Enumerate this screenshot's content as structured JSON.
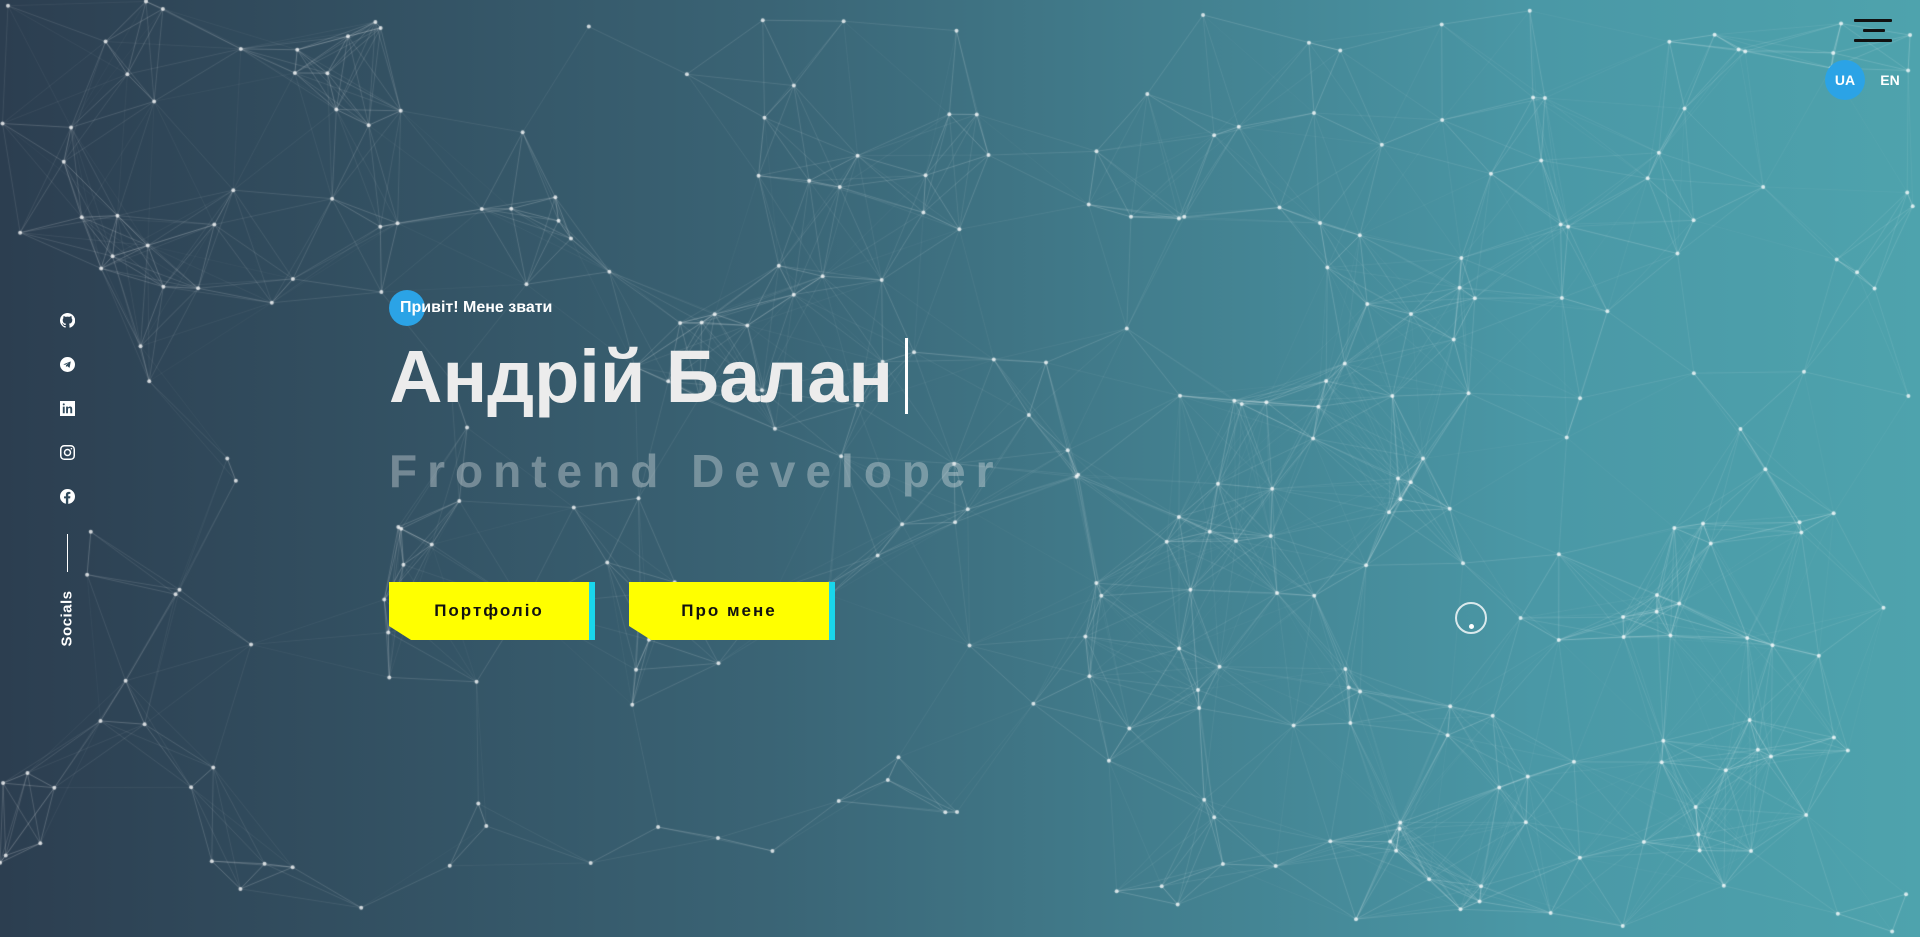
{
  "header": {
    "menu_icon": "hamburger-icon",
    "languages": [
      {
        "label": "UA",
        "active": true
      },
      {
        "label": "EN",
        "active": false
      }
    ]
  },
  "socials": {
    "label": "Socials",
    "items": [
      {
        "icon": "github-icon"
      },
      {
        "icon": "telegram-icon"
      },
      {
        "icon": "linkedin-icon"
      },
      {
        "icon": "instagram-icon"
      },
      {
        "icon": "facebook-icon"
      }
    ]
  },
  "hero": {
    "greeting": "Привіт! Мене звати",
    "name": "Андрій Балан",
    "role": "Frontend Developer",
    "buttons": [
      {
        "label": "Портфоліо"
      },
      {
        "label": "Про мене"
      }
    ]
  },
  "colors": {
    "accent": "#2ba3e6",
    "button": "#ffff00",
    "button_edge": "#19d6ec",
    "gradient_start": "#2c3e50",
    "gradient_end": "#4ea3ad"
  }
}
